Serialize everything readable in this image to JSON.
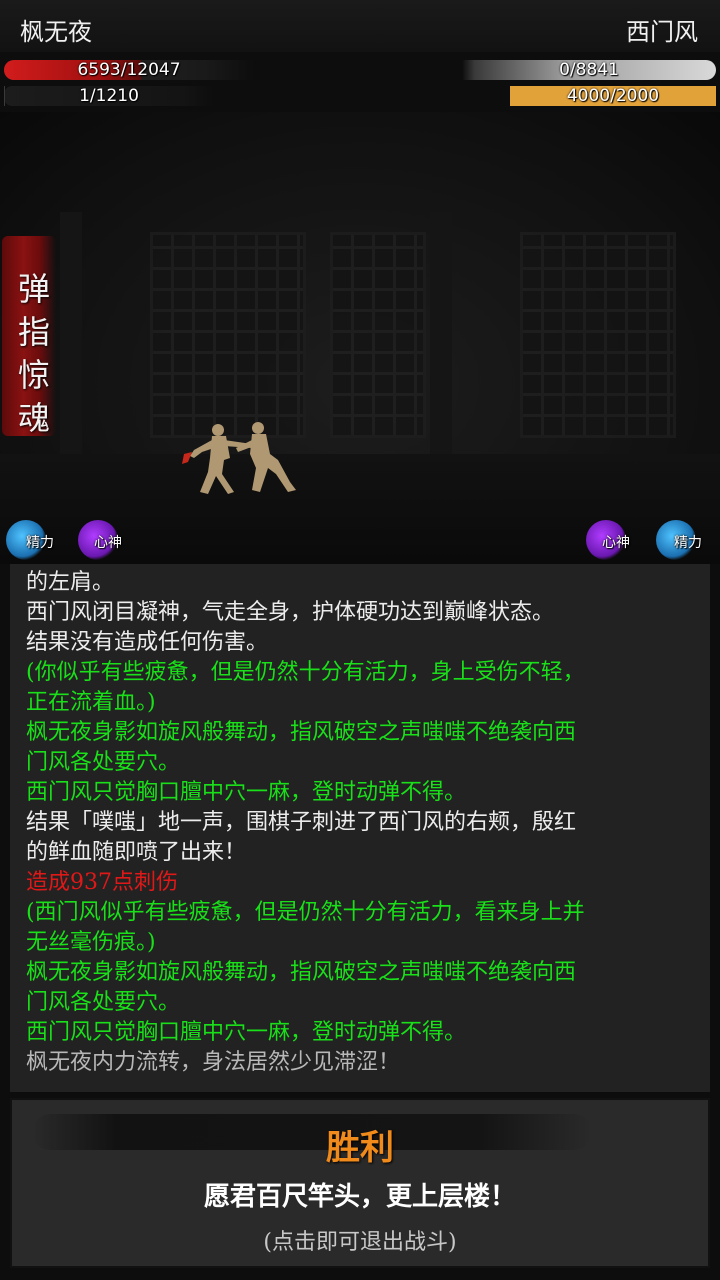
{
  "header": {
    "player_name": "枫无夜",
    "enemy_name": "西门风"
  },
  "player": {
    "hp_text": "6593/12047",
    "hp_fraction": 0.547,
    "mp_text": "1/1210",
    "mp_fraction": 0.001
  },
  "enemy": {
    "hp_text": "0/8841",
    "hp_fraction": 0,
    "mp_text": "4000/2000",
    "mp_fraction": 1
  },
  "skill_name": "弹指惊魂",
  "status_orbs": {
    "left_energy": "精力",
    "left_mind": "心神",
    "right_mind": "心神",
    "right_energy": "精力"
  },
  "colors": {
    "green_text": "#19e019",
    "red_text": "#e01818",
    "victory": "#f08a1a"
  },
  "log": [
    {
      "text": "的左肩。",
      "color": "white"
    },
    {
      "text": "西门风闭目凝神，气走全身，护体硬功达到巅峰状态。",
      "color": "white"
    },
    {
      "text": "结果没有造成任何伤害。",
      "color": "white"
    },
    {
      "text": "(你似乎有些疲惫，但是仍然十分有活力，身上受伤不轻，",
      "color": "green"
    },
    {
      "text": "正在流着血。)",
      "color": "green"
    },
    {
      "text": "枫无夜身影如旋风般舞动，指风破空之声嗤嗤不绝袭向西",
      "color": "green"
    },
    {
      "text": "门风各处要穴。",
      "color": "green"
    },
    {
      "text": "西门风只觉胸口膻中穴一麻，登时动弹不得。",
      "color": "green"
    },
    {
      "text": "结果「噗嗤」地一声，围棋子刺进了西门风的右颊，殷红",
      "color": "white"
    },
    {
      "text": "的鲜血随即喷了出来！",
      "color": "white"
    },
    {
      "text": "造成937点刺伤",
      "color": "red"
    },
    {
      "text": "(西门风似乎有些疲惫，但是仍然十分有活力，看来身上并",
      "color": "green"
    },
    {
      "text": "无丝毫伤痕。)",
      "color": "green"
    },
    {
      "text": "枫无夜身影如旋风般舞动，指风破空之声嗤嗤不绝袭向西",
      "color": "green"
    },
    {
      "text": "门风各处要穴。",
      "color": "green"
    },
    {
      "text": "西门风只觉胸口膻中穴一麻，登时动弹不得。",
      "color": "green"
    },
    {
      "text": "枫无夜内力流转，身法居然少见滞涩！",
      "color": "gray"
    }
  ],
  "result": {
    "title": "胜利",
    "motto": "愿君百尺竿头，更上层楼！",
    "exit_hint": "(点击即可退出战斗)"
  }
}
